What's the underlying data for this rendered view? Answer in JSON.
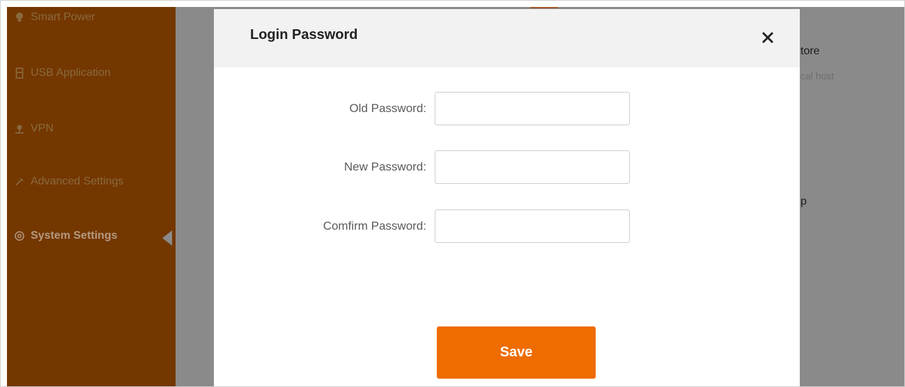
{
  "sidebar": {
    "items": [
      {
        "label": "Smart Power",
        "icon": "bulb-icon"
      },
      {
        "label": "USB Application",
        "icon": "usb-icon"
      },
      {
        "label": "VPN",
        "icon": "vpn-icon"
      },
      {
        "label": "Advanced Settings",
        "icon": "wrench-icon"
      },
      {
        "label": "System Settings",
        "icon": "gear-icon",
        "active": true
      }
    ]
  },
  "background": {
    "text_1": "tore",
    "text_2": "cal host",
    "text_3": "p"
  },
  "modal": {
    "title": "Login Password",
    "close_icon": "close-icon",
    "fields": [
      {
        "label": "Old Password:",
        "value": "",
        "placeholder": ""
      },
      {
        "label": "New Password:",
        "value": "",
        "placeholder": ""
      },
      {
        "label": "Comfirm Password:",
        "value": "",
        "placeholder": ""
      }
    ],
    "save_label": "Save"
  },
  "colors": {
    "sidebar_bg": "#743700",
    "overlay": "#8a8a8a",
    "accent": "#ef6c00"
  }
}
